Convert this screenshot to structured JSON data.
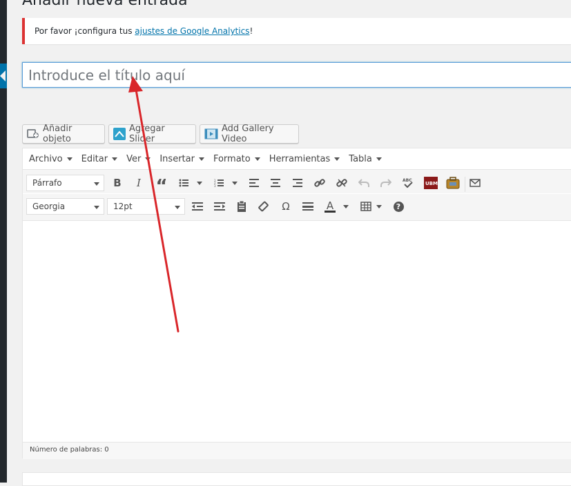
{
  "page": {
    "title": "Añadir nueva entrada"
  },
  "notice": {
    "text_before": "Por favor ¡configura tus ",
    "link_text": "ajustes de Google Analytics",
    "text_after": "!",
    "border_color": "#dc3232"
  },
  "post_title": {
    "placeholder": "Introduce el título aquí",
    "value": ""
  },
  "media_buttons": [
    {
      "label": "Añadir objeto",
      "icon": "add-media-icon"
    },
    {
      "label": "Agregar Slider",
      "icon": "slider-icon"
    },
    {
      "label": "Add Gallery Video",
      "icon": "video-gallery-icon"
    }
  ],
  "menubar": [
    {
      "label": "Archivo"
    },
    {
      "label": "Editar"
    },
    {
      "label": "Ver"
    },
    {
      "label": "Insertar"
    },
    {
      "label": "Formato"
    },
    {
      "label": "Herramientas"
    },
    {
      "label": "Tabla"
    }
  ],
  "toolbar1": {
    "format_select": "Párrafo",
    "bold": "B",
    "italic": "I",
    "blockquote": "“"
  },
  "toolbar2": {
    "font_family": "Georgia",
    "font_size": "12pt",
    "special_char": "Ω",
    "text_color": "A",
    "help": "?"
  },
  "status_bar": {
    "word_count": "Número de palabras: 0"
  },
  "colors": {
    "accent": "#0073aa",
    "annotation_arrow": "#d9262a"
  }
}
